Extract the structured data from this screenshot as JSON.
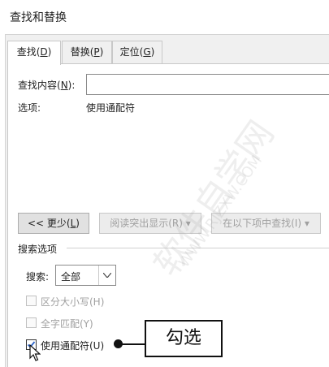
{
  "window": {
    "title": "查找和替换"
  },
  "tabs": [
    {
      "label": "查找(",
      "key": "D",
      "close": ")"
    },
    {
      "label": "替换(",
      "key": "P",
      "close": ")"
    },
    {
      "label": "定位(",
      "key": "G",
      "close": ")"
    }
  ],
  "find": {
    "label_pre": "查找内容(",
    "label_key": "N",
    "label_post": "):",
    "value": "",
    "options_label": "选项:",
    "options_value": "使用通配符"
  },
  "buttons": {
    "less_pre": "<< 更少(",
    "less_key": "L",
    "less_post": ")",
    "highlight": "阅读突出显示(R) ▾",
    "find_in": "在以下项中查找(I) ▾"
  },
  "search_options": {
    "group_title": "搜索选项",
    "search_label": "搜索:",
    "search_value": "全部",
    "checkboxes": [
      {
        "label": "区分大小写(H)",
        "checked": false,
        "enabled": false
      },
      {
        "label": "全字匹配(Y)",
        "checked": false,
        "enabled": false
      },
      {
        "label": "使用通配符(U)",
        "checked": true,
        "enabled": true
      }
    ]
  },
  "annotation": {
    "text": "勾选"
  },
  "watermark": {
    "text": "软件自学网",
    "url": "WWW.RJZXW.COM"
  }
}
